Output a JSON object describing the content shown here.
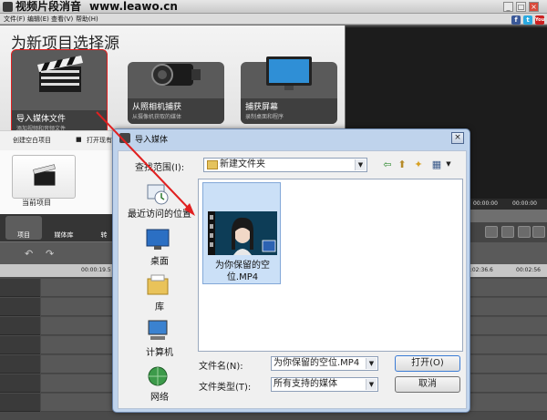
{
  "window": {
    "title": "视频片段消音",
    "watermark": "www.leawo.cn",
    "min": "_",
    "max": "□",
    "close": "×"
  },
  "menu": [
    {
      "label": "文件(F)"
    },
    {
      "label": "编辑(E)"
    },
    {
      "label": "查看(V)"
    },
    {
      "label": "帮助(H)"
    }
  ],
  "social": [
    "f",
    "t",
    "You"
  ],
  "heading": "为新项目选择源",
  "tiles": [
    {
      "title": "导入媒体文件",
      "subtitle": "添加视频和音频文件",
      "highlighted": true
    },
    {
      "title": "从照相机捕获",
      "subtitle": "从摄像机获取的媒体"
    },
    {
      "title": "捕获屏幕",
      "subtitle": "录制桌面和程序"
    }
  ],
  "actions": {
    "create_blank": "创建空白项目",
    "open_existing": "打开现有项"
  },
  "project": {
    "current": "当前项目"
  },
  "tabs": [
    {
      "label": "项目"
    },
    {
      "label": "媒体库"
    },
    {
      "label": "转"
    }
  ],
  "preview": {
    "time_left": "00:00:00",
    "time_right": "00:00:00"
  },
  "ruler": {
    "t1": "00:00:19.5",
    "t2": "0:02:36.6",
    "t3": "00:02:56"
  },
  "dialog": {
    "title": "导入媒体",
    "close": "×",
    "lookin_label": "查找范围(I):",
    "lookin_value": "新建文件夹",
    "places": [
      {
        "label": "最近访问的位置"
      },
      {
        "label": "桌面"
      },
      {
        "label": "库"
      },
      {
        "label": "计算机"
      },
      {
        "label": "网络"
      }
    ],
    "file": {
      "name": "为你保留的空位.MP4"
    },
    "filename_label": "文件名(N):",
    "filename_value": "为你保留的空位.MP4",
    "filetype_label": "文件类型(T):",
    "filetype_value": "所有支持的媒体",
    "open_button": "打开(O)",
    "cancel_button": "取消"
  },
  "colors": {
    "highlight_border": "#e02020",
    "dialog_frame": "#bfd3ec",
    "selected_file": "#cbe0f7"
  }
}
